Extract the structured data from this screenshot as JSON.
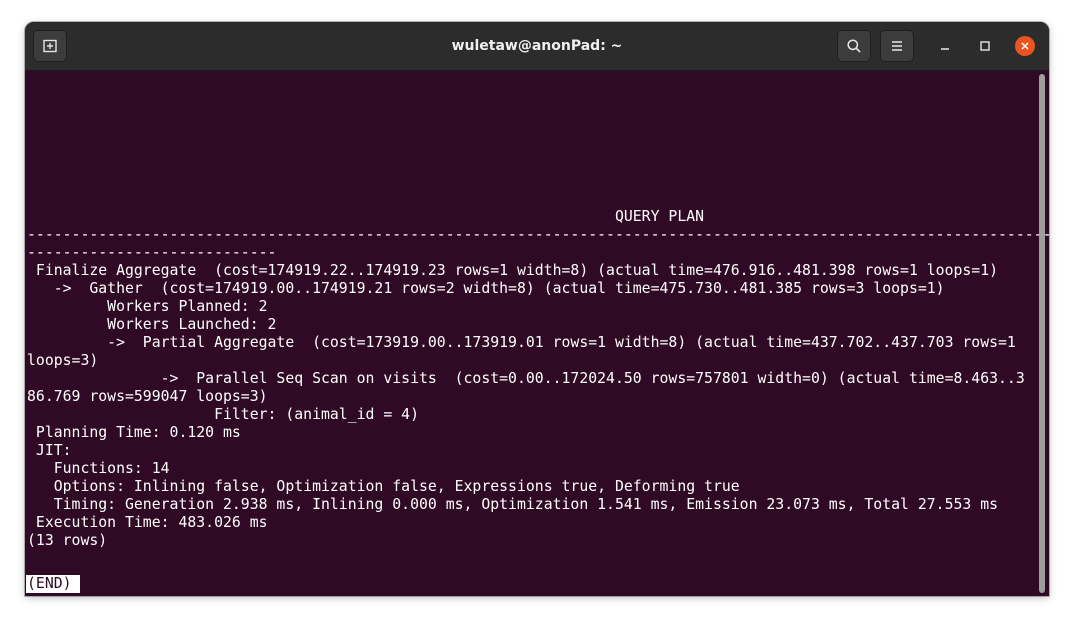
{
  "window": {
    "title": "wuletaw@anonPad: ~"
  },
  "titlebar": {
    "new_tab_icon": "new-tab-icon",
    "search_icon": "search-icon",
    "menu_icon": "hamburger-menu-icon",
    "minimize_icon": "minimize-icon",
    "maximize_icon": "maximize-icon",
    "close_icon": "close-icon",
    "close_color": "#e95420"
  },
  "terminal": {
    "background": "#300a24",
    "foreground": "#ffffff",
    "lines": [
      "                                                                  QUERY PLAN",
      "----------------------------------------------------------------------------------------------------------------------",
      "----------------------------",
      " Finalize Aggregate  (cost=174919.22..174919.23 rows=1 width=8) (actual time=476.916..481.398 rows=1 loops=1)",
      "   ->  Gather  (cost=174919.00..174919.21 rows=2 width=8) (actual time=475.730..481.385 rows=3 loops=1)",
      "         Workers Planned: 2",
      "         Workers Launched: 2",
      "         ->  Partial Aggregate  (cost=173919.00..173919.01 rows=1 width=8) (actual time=437.702..437.703 rows=1",
      "loops=3)",
      "               ->  Parallel Seq Scan on visits  (cost=0.00..172024.50 rows=757801 width=0) (actual time=8.463..3",
      "86.769 rows=599047 loops=3)",
      "                     Filter: (animal_id = 4)",
      " Planning Time: 0.120 ms",
      " JIT:",
      "   Functions: 14",
      "   Options: Inlining false, Optimization false, Expressions true, Deforming true",
      "   Timing: Generation 2.938 ms, Inlining 0.000 ms, Optimization 1.541 ms, Emission 23.073 ms, Total 27.553 ms",
      " Execution Time: 483.026 ms",
      "(13 rows)"
    ],
    "pager_status": "(END)"
  }
}
